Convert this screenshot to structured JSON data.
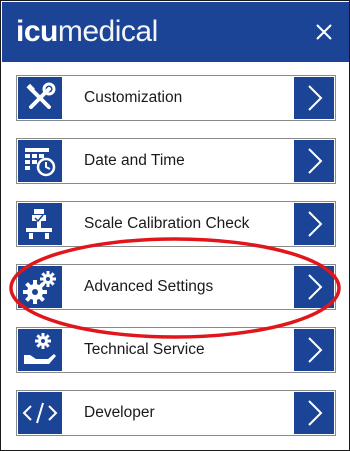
{
  "header": {
    "logo_bold": "icu",
    "logo_light": "medical",
    "close_icon": "close-icon"
  },
  "menu": {
    "items": [
      {
        "label": "Customization",
        "icon": "wrench-screwdriver-icon"
      },
      {
        "label": "Date and Time",
        "icon": "calendar-clock-icon"
      },
      {
        "label": "Scale Calibration Check",
        "icon": "scale-icon"
      },
      {
        "label": "Advanced Settings",
        "icon": "gears-icon"
      },
      {
        "label": "Technical Service",
        "icon": "hand-gear-icon"
      },
      {
        "label": "Developer",
        "icon": "code-icon"
      }
    ],
    "chevron_icon": "chevron-right-icon"
  },
  "annotation": {
    "color": "#e0161b",
    "target": "Advanced Settings"
  },
  "colors": {
    "brand_blue": "#1b4496",
    "text": "#1a1a1a",
    "border": "#8a8a8a"
  }
}
